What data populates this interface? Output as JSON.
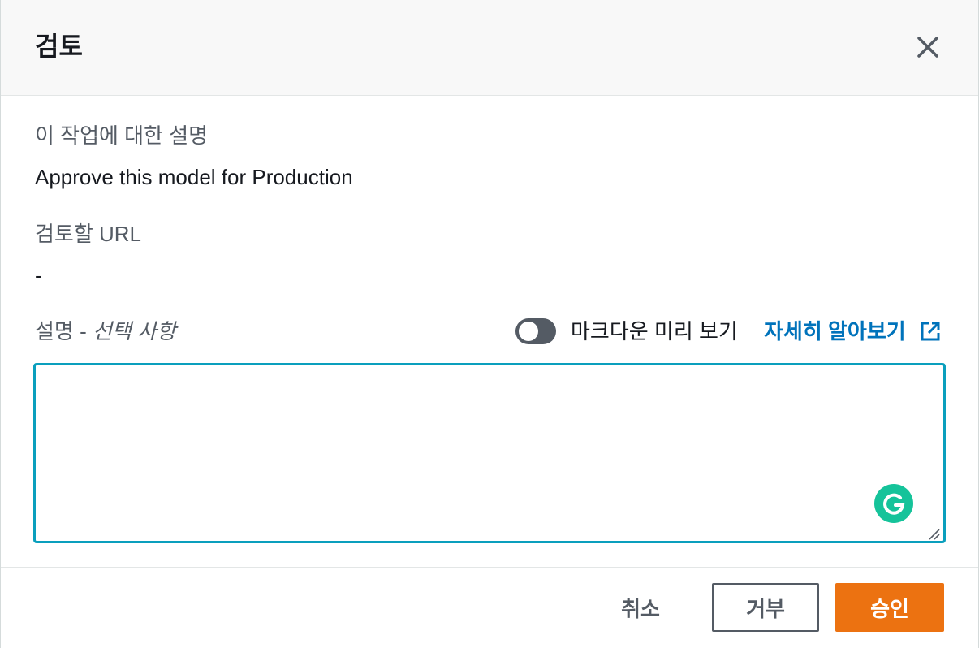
{
  "dialog": {
    "title": "검토"
  },
  "fields": {
    "task_description_label": "이 작업에 대한 설명",
    "task_description_value": "Approve this model for Production",
    "review_url_label": "검토할 URL",
    "review_url_value": "-",
    "comment_label": "설명 - ",
    "comment_optional": "선택 사항",
    "comment_value": ""
  },
  "markdown_toggle": {
    "label": "마크다운 미리 보기",
    "enabled": false
  },
  "learn_more": {
    "label": "자세히 알아보기"
  },
  "footer": {
    "cancel_label": "취소",
    "reject_label": "거부",
    "approve_label": "승인"
  },
  "colors": {
    "accent": "#0a9fbd",
    "link": "#0073bb",
    "primary_button": "#ec7211",
    "grammarly": "#15c39a"
  },
  "icons": {
    "close": "close-icon",
    "external": "external-link-icon",
    "grammarly": "grammarly-icon",
    "resize": "resize-handle-icon"
  }
}
